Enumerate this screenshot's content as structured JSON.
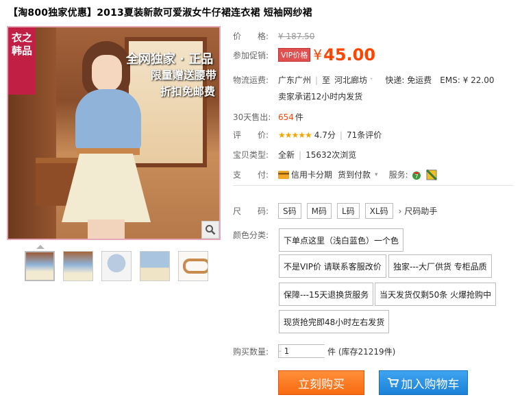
{
  "title": "【淘800独家优惠】2013夏装新款可爱淑女牛仔裙连衣裙 短袖网纱裙",
  "image": {
    "banner": "衣之韩品",
    "promo1": "全网独家 · 正品",
    "promo2": "限量赠送腰带",
    "promo3": "折扣免邮费"
  },
  "price": {
    "label": "价　　格:",
    "original": "¥ 187.50"
  },
  "promo": {
    "label": "参加促销:",
    "tag": "VIP价格",
    "currency": "¥",
    "amount": "45.00"
  },
  "shipping": {
    "label": "物流运费:",
    "from": "广东广州",
    "to_word": "至",
    "to": "河北廊坊",
    "express": "快递: 免运费",
    "ems": "EMS: ¥ 22.00",
    "promise": "卖家承诺12小时内发货"
  },
  "sales": {
    "label": "30天售出:",
    "count": "654",
    "unit": "件"
  },
  "rating": {
    "label": "评　　价:",
    "stars": "★★★★★",
    "score": "4.7分",
    "reviews": "71条评价"
  },
  "type": {
    "label": "宝贝类型:",
    "condition": "全新",
    "views": "15632次浏览"
  },
  "payment": {
    "label": "支　　付:",
    "credit": "信用卡分期",
    "cod": "货到付款",
    "service": "服务:"
  },
  "size": {
    "label": "尺　　码:",
    "options": [
      "S码",
      "M码",
      "L码",
      "XL码"
    ],
    "helper": "尺码助手"
  },
  "color": {
    "label": "颜色分类:",
    "options": [
      "下单点这里（浅白蓝色）一个色",
      "不是VIP价 请联系客服改价",
      "独家---大厂供货 专柜品质",
      "保障---15天退换货服务",
      "当天发货仅剩50条 火爆抢购中",
      "现货抢完即48小时左右发货"
    ]
  },
  "quantity": {
    "label": "购买数量:",
    "value": "1",
    "unit": "件 (库存21219件)"
  },
  "buttons": {
    "buy": "立刻购买",
    "cart": "加入购物车"
  },
  "colors": {
    "accent": "#ff4400",
    "buy": "#f86a10",
    "cart": "#1b82d8"
  }
}
